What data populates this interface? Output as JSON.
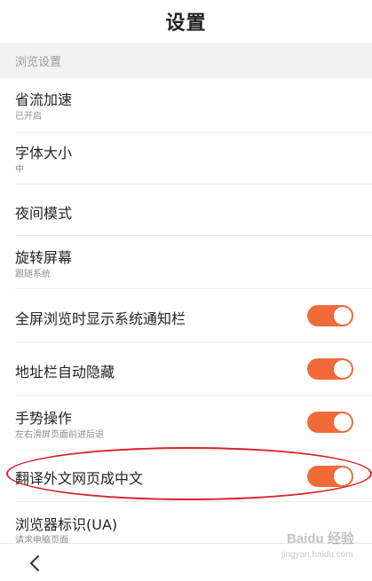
{
  "header": {
    "title": "设置"
  },
  "section": {
    "label": "浏览设置"
  },
  "settings": [
    {
      "title": "省流加速",
      "subtitle": "已开启"
    },
    {
      "title": "字体大小",
      "subtitle": "中"
    },
    {
      "title": "夜间模式"
    },
    {
      "title": "旋转屏幕",
      "subtitle": "跟随系统"
    },
    {
      "title": "全屏浏览时显示系统通知栏",
      "toggle_on": true
    },
    {
      "title": "地址栏自动隐藏",
      "toggle_on": true
    },
    {
      "title": "手势操作",
      "subtitle": "左右滑屏页面前进后退",
      "toggle_on": true
    },
    {
      "title": "翻译外文网页成中文",
      "toggle_on": true
    },
    {
      "title": "浏览器标识(UA)",
      "subtitle": "请求电脑页面"
    }
  ],
  "nav": {
    "back_icon": "chevron-left-icon"
  },
  "watermark": {
    "brand": "Baidu 经验",
    "url": "jingyan.baidu.com"
  },
  "colors": {
    "toggle_on": "#f06a3a",
    "highlight_ellipse": "#d8222a",
    "section_bg": "#f2f2f2"
  }
}
